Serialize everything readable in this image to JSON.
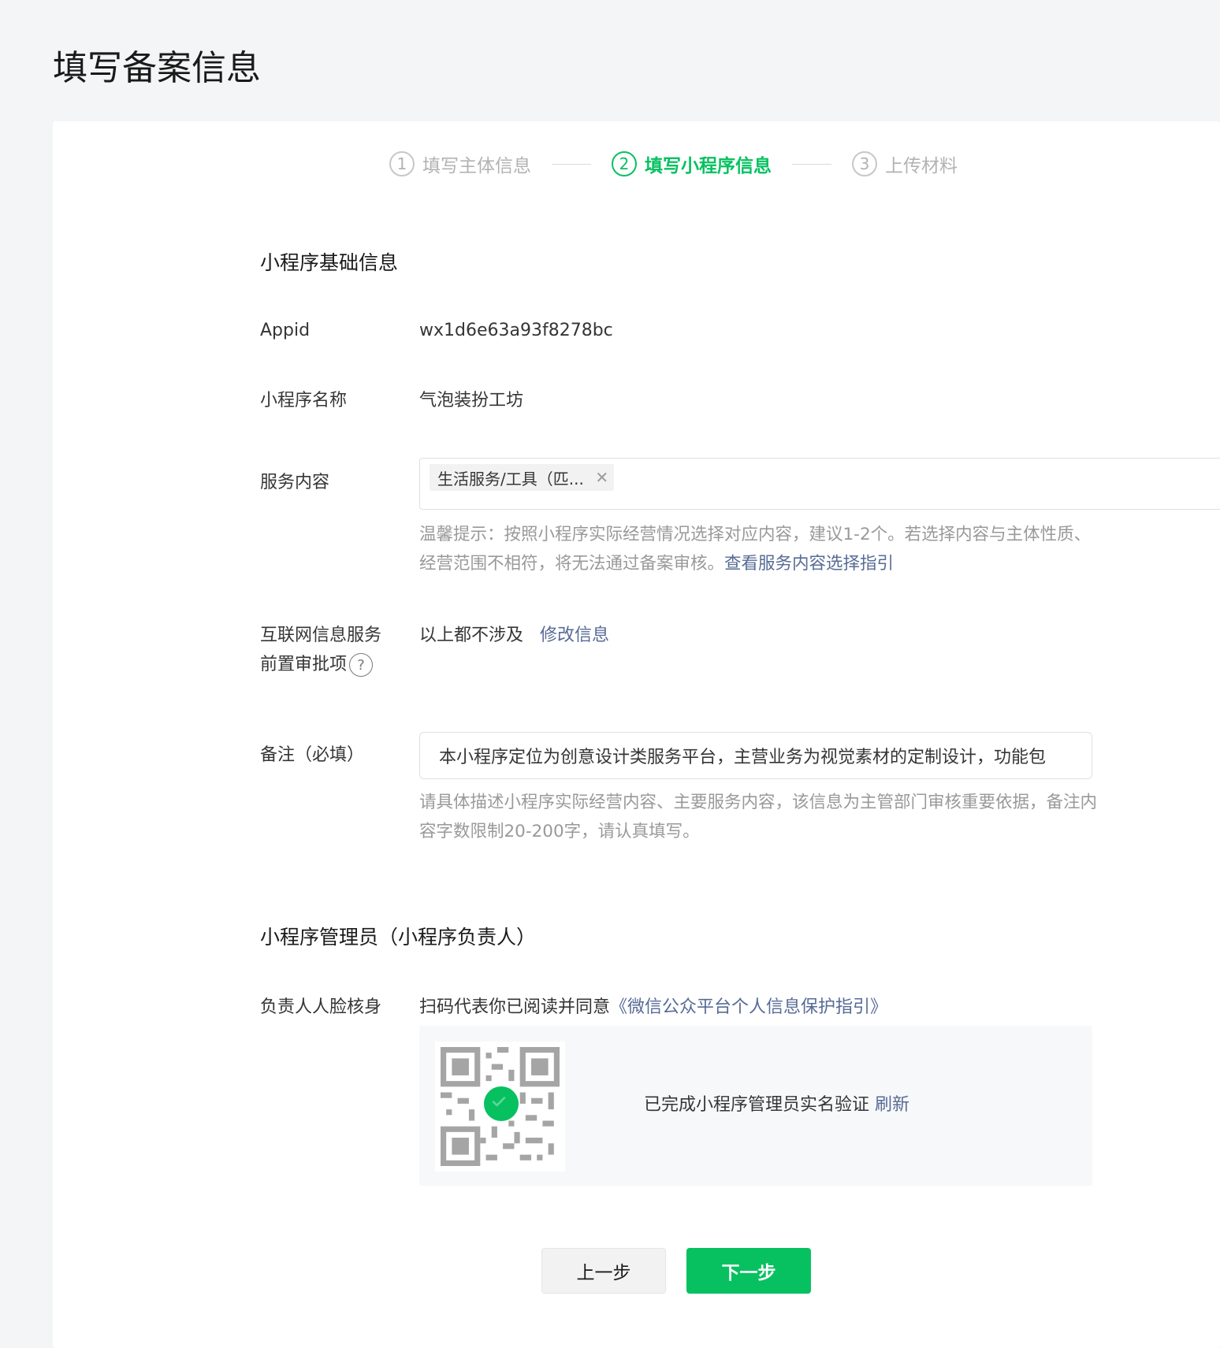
{
  "page": {
    "title": "填写备案信息"
  },
  "steps": [
    {
      "num": "1",
      "label": "填写主体信息",
      "state": "done"
    },
    {
      "num": "2",
      "label": "填写小程序信息",
      "state": "active"
    },
    {
      "num": "3",
      "label": "上传材料",
      "state": "pending"
    }
  ],
  "basic": {
    "title": "小程序基础信息",
    "appid_label": "Appid",
    "appid_value": "wx1d6e63a93f8278bc",
    "name_label": "小程序名称",
    "name_value": "气泡装扮工坊",
    "service_label": "服务内容",
    "service_tag": "生活服务/工具（匹...",
    "service_tip": "温馨提示：按照小程序实际经营情况选择对应内容，建议1-2个。若选择内容与主体性质、经营范围不相符，将无法通过备案审核。",
    "service_tip_link": "查看服务内容选择指引",
    "approval_label_line1": "互联网信息服务",
    "approval_label_line2": "前置审批项",
    "approval_value": "以上都不涉及",
    "approval_link": "修改信息",
    "remark_label": "备注（必填）",
    "remark_value": "本小程序定位为创意设计类服务平台，主营业务为视觉素材的定制设计，功能包",
    "remark_tip": "请具体描述小程序实际经营内容、主要服务内容，该信息为主管部门审核重要依据，备注内容字数限制20-200字，请认真填写。"
  },
  "admin": {
    "title": "小程序管理员（小程序负责人）",
    "face_label": "负责人人脸核身",
    "agree_text": "扫码代表你已阅读并同意",
    "agree_link": "《微信公众平台个人信息保护指引》",
    "status_text": "已完成小程序管理员实名验证",
    "refresh_link": "刷新"
  },
  "buttons": {
    "prev": "上一步",
    "next": "下一步"
  },
  "colors": {
    "accent": "#07c160",
    "link": "#576b95",
    "muted": "#999999"
  }
}
